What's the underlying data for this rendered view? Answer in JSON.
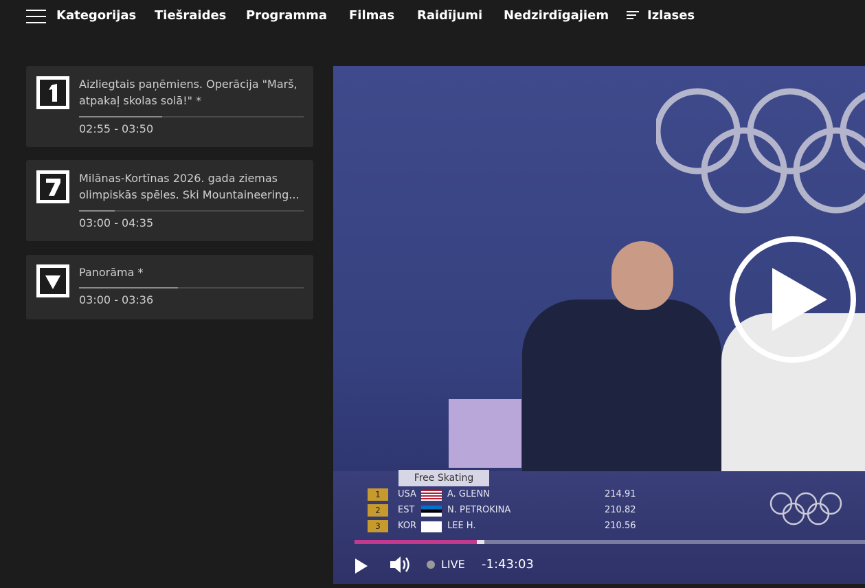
{
  "nav": {
    "items": [
      "Kategorijas",
      "Tiešraides",
      "Programma",
      "Filmas",
      "Raidījumi",
      "Nedzirdīgajiem",
      "Izlases"
    ]
  },
  "channels": [
    {
      "logo": "ltv1-logo",
      "title": "Aizliegtais paņēmiens. Operācija \"Marš, atpakaļ skolas solā!\" *",
      "time": "02:55 - 03:50",
      "progress": 0.37
    },
    {
      "logo": "ltv7-logo",
      "title": "Milānas-Kortīnas 2026. gada ziemas olimpiskās spēles. Ski Mountaineering...",
      "time": "03:00 - 04:35",
      "progress": 0.16
    },
    {
      "logo": "panorama-logo",
      "title": "Panorāma *",
      "time": "03:00 - 03:36",
      "progress": 0.44
    }
  ],
  "video": {
    "scoreboard_title": "Free Skating",
    "rows": [
      {
        "rank": "1",
        "code": "USA",
        "name": "A. GLENN",
        "points": "214.91"
      },
      {
        "rank": "2",
        "code": "EST",
        "name": "N. PETROKINA",
        "points": "210.82"
      },
      {
        "rank": "3",
        "code": "KOR",
        "name": "LEE H.",
        "points": "210.56"
      }
    ],
    "progress": 0.24,
    "live_label": "LIVE",
    "time": "-1:43:03"
  },
  "colors": {
    "accent": "#c23a8e",
    "background": "#1c1c1c",
    "card": "#2b2b2b"
  }
}
